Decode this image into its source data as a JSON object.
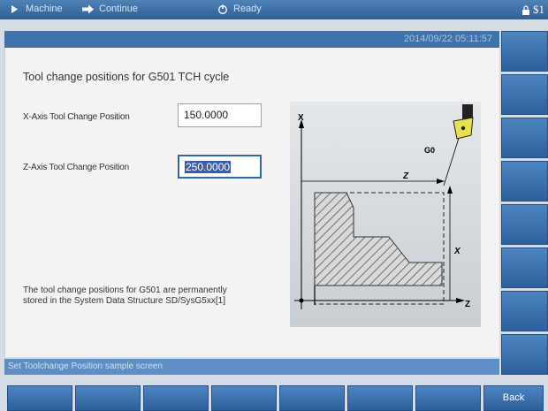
{
  "topbar": {
    "machine_label": "Machine",
    "continue_label": "Continue",
    "ready_label": "Ready",
    "right_label": "$1"
  },
  "header": {
    "datetime": "2014/09/22   05:11:57"
  },
  "form": {
    "title": "Tool change positions for G501 TCH cycle",
    "x_label": "X-Axis Tool Change Position",
    "x_value": "150.0000",
    "z_label": "Z-Axis Tool Change Position",
    "z_value": "250.0000",
    "note": "The tool change positions for G501 are permanently stored in the System Data Structure SD/SysG5xx[1]"
  },
  "diagram": {
    "x_axis_label": "X",
    "z_axis_label": "Z",
    "g0_label": "G0",
    "z_dim_label": "Z",
    "x_dim_label": "X"
  },
  "statusbar": {
    "text": "Set Toolchange Position sample screen"
  },
  "softkeys": {
    "back_label": "Back"
  },
  "colors": {
    "accent": "#3f73ad",
    "field_highlight": "#3a5ea8",
    "tool": "#e8e24a"
  }
}
